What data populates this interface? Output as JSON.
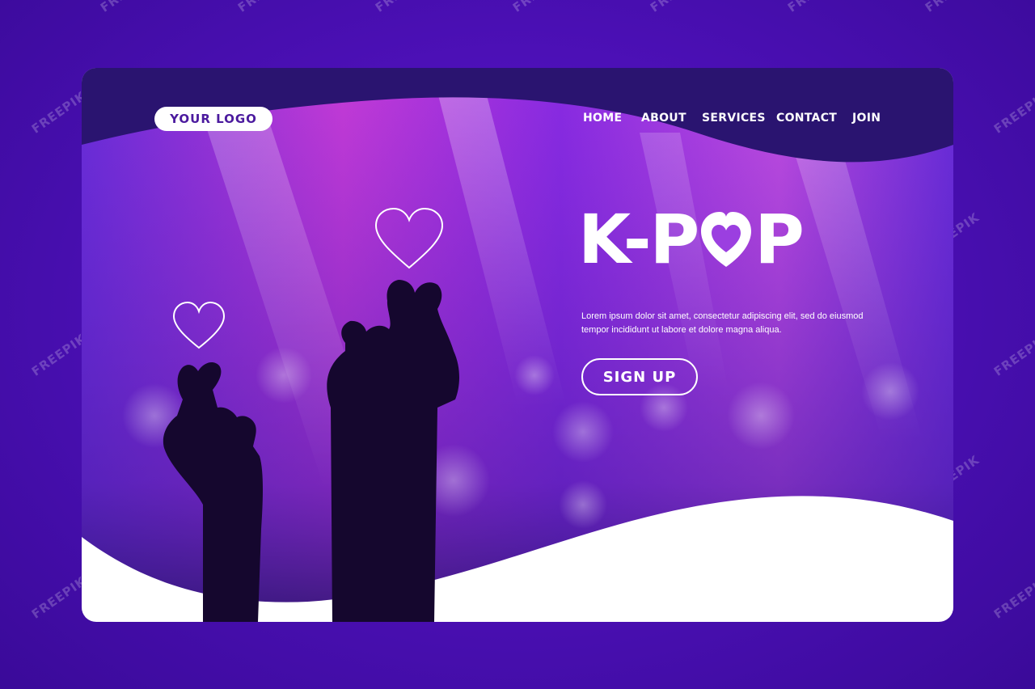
{
  "logo": {
    "label": "YOUR LOGO"
  },
  "nav": {
    "home": "HOME",
    "about": "ABOUT",
    "services": "SERVICES",
    "contact": "CONTACT",
    "join": "JOIN"
  },
  "hero": {
    "title_left": "K-P",
    "title_right": "P",
    "description": "Lorem ipsum dolor sit amet, consectetur adipiscing elit, sed do eiusmod tempor incididunt ut labore et dolore magna aliqua.",
    "cta": "SIGN UP"
  },
  "watermark": "FREEPIK",
  "colors": {
    "background": "#4d10b8",
    "header_band": "#2a1470",
    "accent": "#8a2be2",
    "footer_wave": "#ffffff"
  },
  "icons": [
    "heart-outline-icon",
    "finger-heart-hand-silhouette",
    "heart-letter-o"
  ]
}
